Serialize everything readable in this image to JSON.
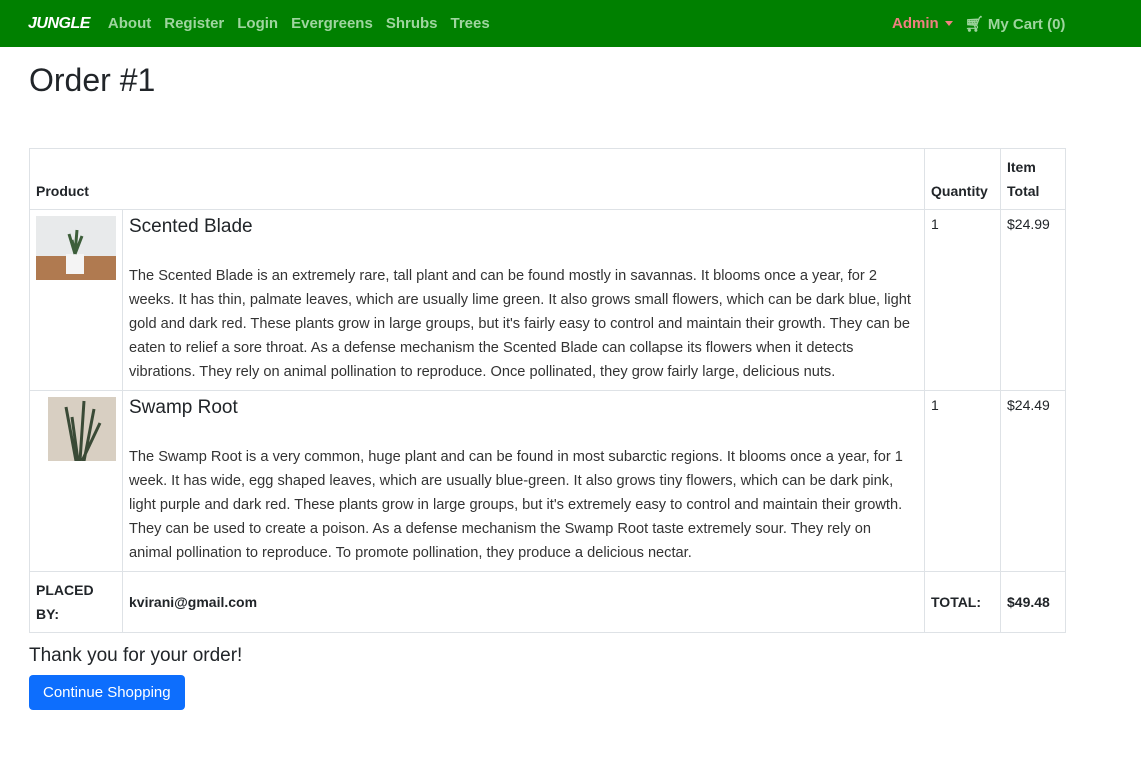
{
  "nav": {
    "brand": "JUNGLE",
    "links": [
      "About",
      "Register",
      "Login",
      "Evergreens",
      "Shrubs",
      "Trees"
    ],
    "admin": "Admin",
    "cart": "My Cart (0)"
  },
  "page": {
    "title": "Order #1"
  },
  "table": {
    "headers": {
      "product": "Product",
      "quantity": "Quantity",
      "item_total": "Item Total"
    },
    "rows": [
      {
        "name": "Scented Blade",
        "description": "The Scented Blade is an extremely rare, tall plant and can be found mostly in savannas. It blooms once a year, for 2 weeks. It has thin, palmate leaves, which are usually lime green. It also grows small flowers, which can be dark blue, light gold and dark red. These plants grow in large groups, but it's fairly easy to control and maintain their growth. They can be eaten to relief a sore throat. As a defense mechanism the Scented Blade can collapse its flowers when it detects vibrations. They rely on animal pollination to reproduce. Once pollinated, they grow fairly large, delicious nuts.",
        "quantity": "1",
        "total": "$24.99"
      },
      {
        "name": "Swamp Root",
        "description": "The Swamp Root is a very common, huge plant and can be found in most subarctic regions. It blooms once a year, for 1 week. It has wide, egg shaped leaves, which are usually blue-green. It also grows tiny flowers, which can be dark pink, light purple and dark red. These plants grow in large groups, but it's extremely easy to control and maintain their growth. They can be used to create a poison. As a defense mechanism the Swamp Root taste extremely sour. They rely on animal pollination to reproduce. To promote pollination, they produce a delicious nectar.",
        "quantity": "1",
        "total": "$24.49"
      }
    ],
    "footer": {
      "placed_by_label": "PLACED BY:",
      "email": "kvirani@gmail.com",
      "total_label": "TOTAL:",
      "total": "$49.48"
    }
  },
  "thanks": "Thank you for your order!",
  "continue_label": "Continue Shopping"
}
